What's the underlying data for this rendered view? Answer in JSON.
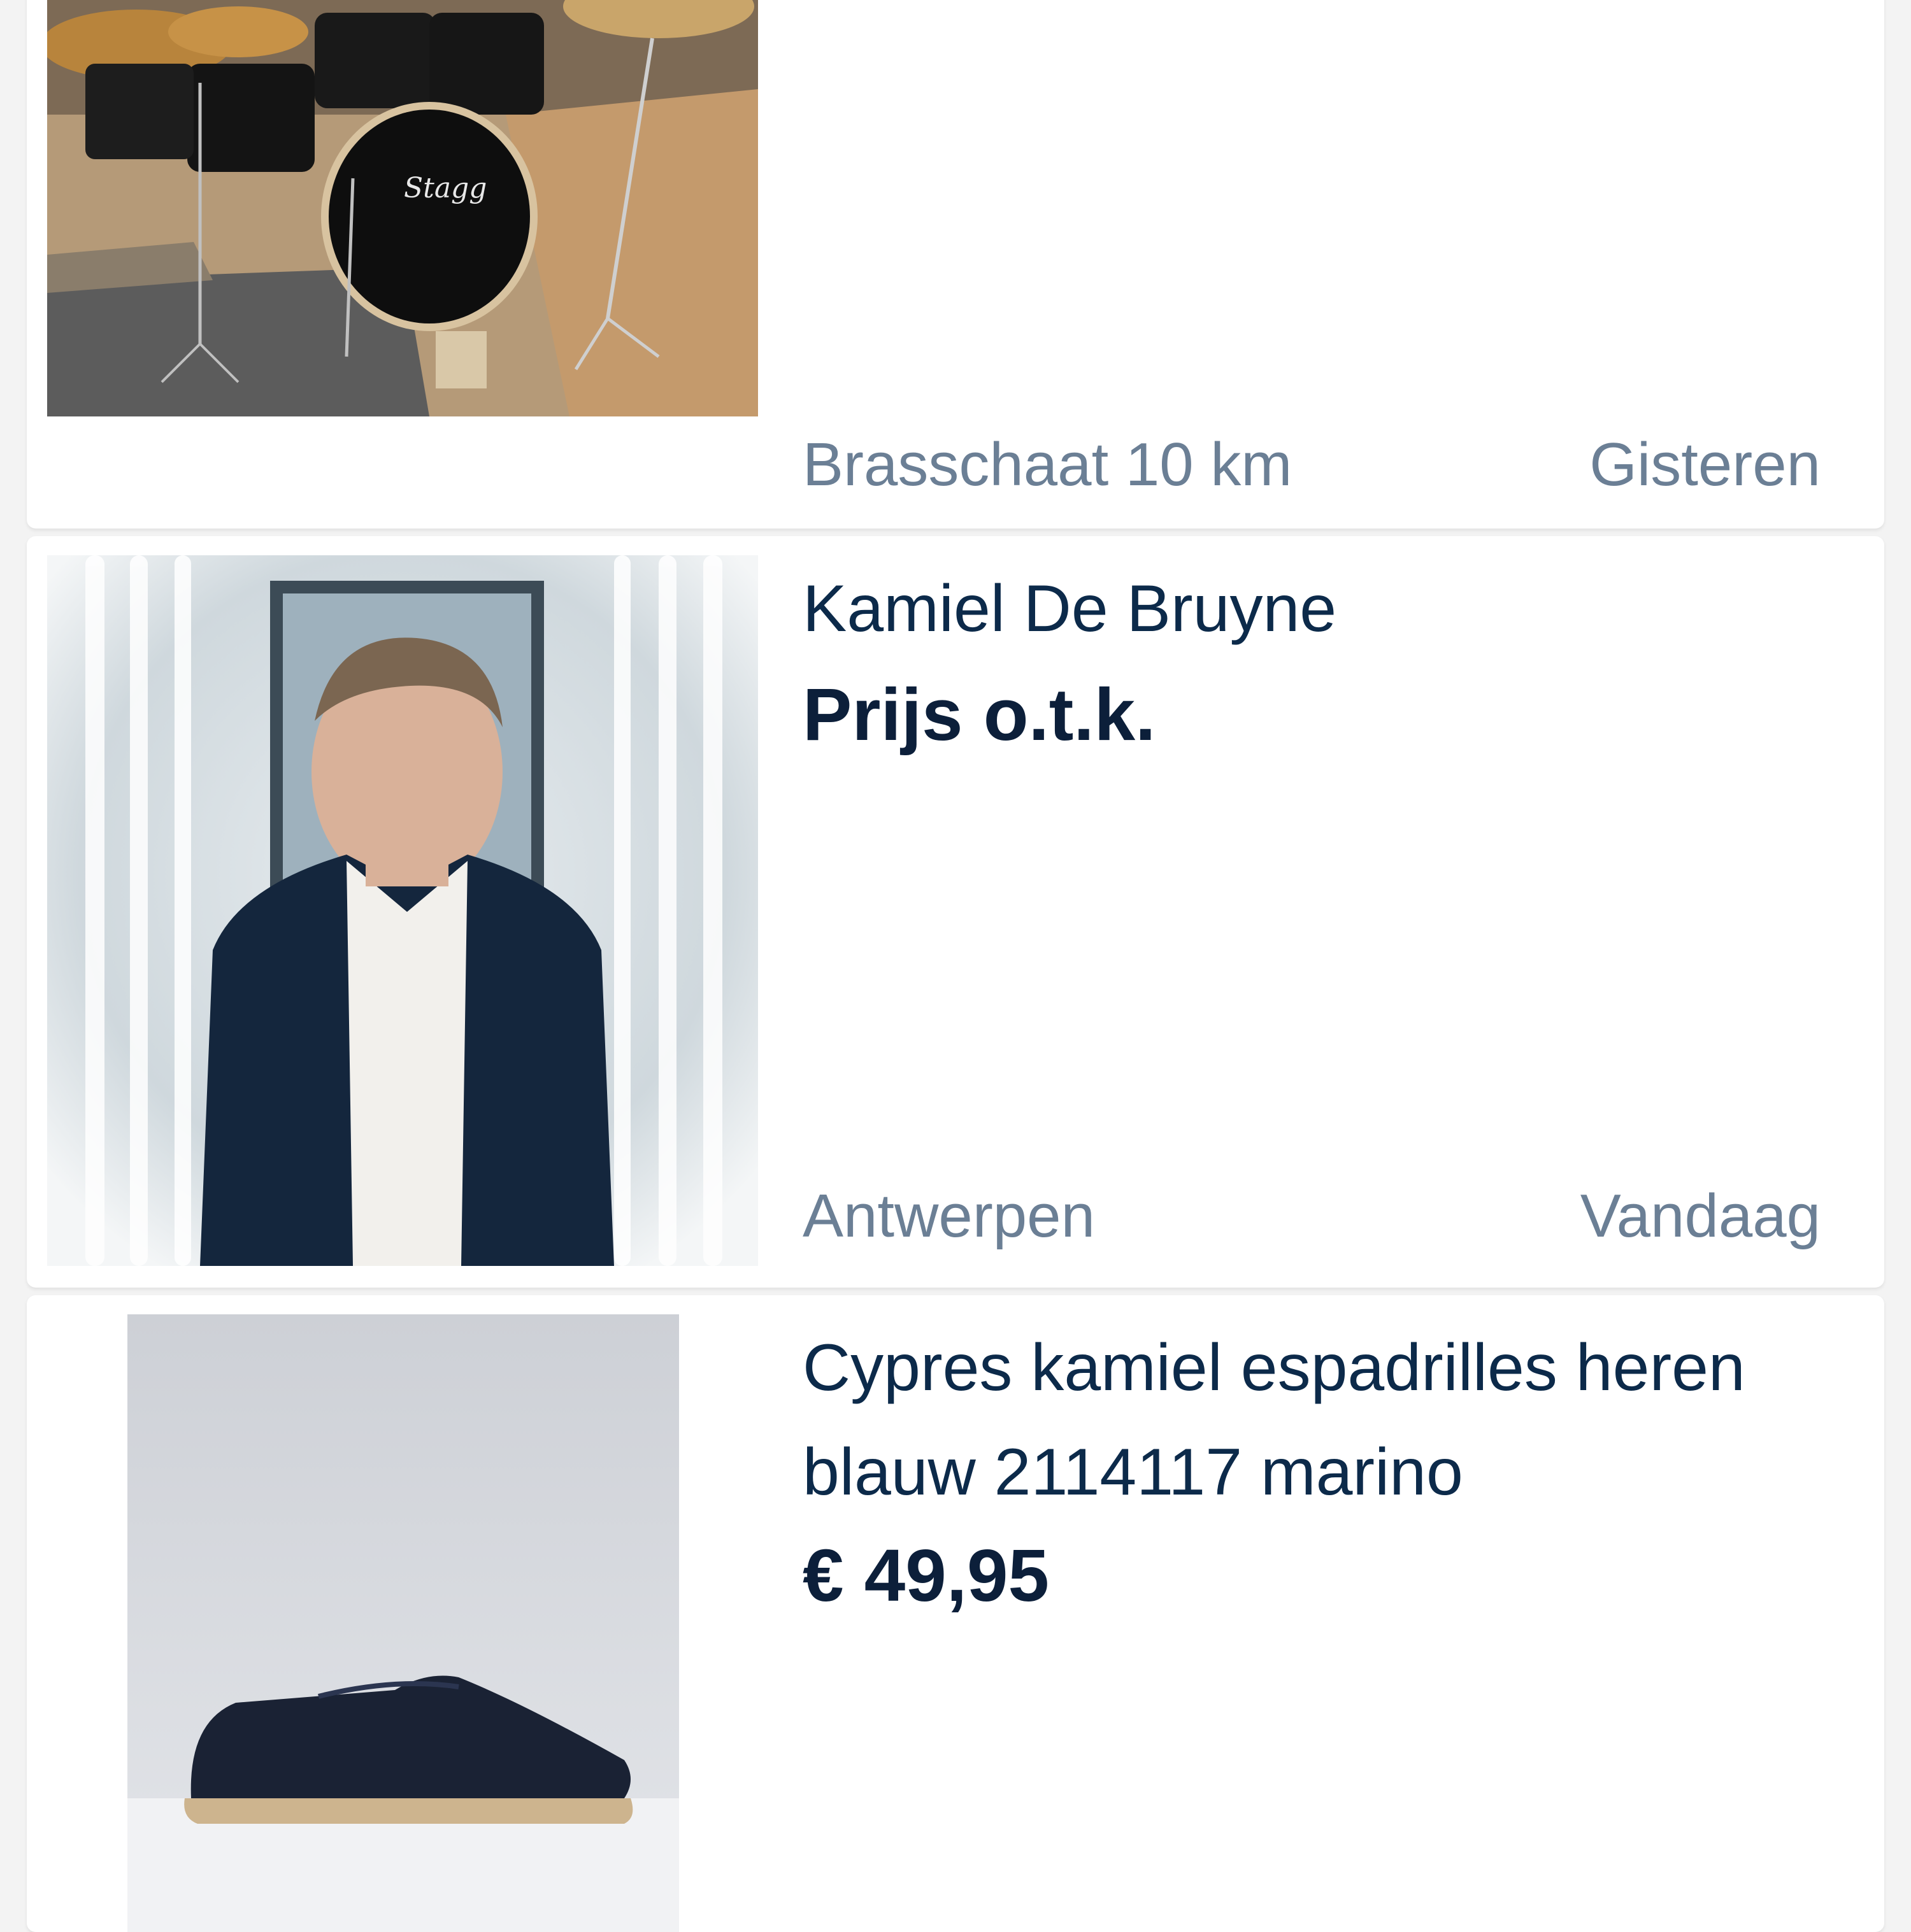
{
  "listings": [
    {
      "image": "drum-kit-photo",
      "location": "Brasschaat 10 km",
      "date": "Gisteren"
    },
    {
      "image": "man-portrait-photo",
      "title": "Kamiel De Bruyne",
      "price": "Prijs o.t.k.",
      "location": "Antwerpen",
      "date": "Vandaag"
    },
    {
      "image": "espadrille-shoe-photo",
      "title": "Cypres kamiel espadrilles heren blauw 2114117 marino",
      "price": "€ 49,95"
    }
  ],
  "colors": {
    "background": "#f3f3f3",
    "card": "#ffffff",
    "title": "#0c2a4a",
    "price": "#0c1f3a",
    "meta": "#6b7f95"
  }
}
